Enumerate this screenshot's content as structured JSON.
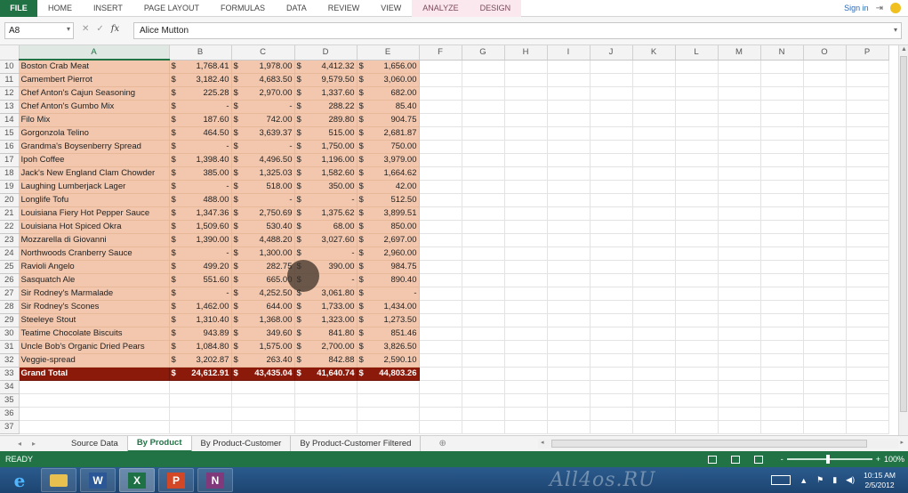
{
  "ribbon": {
    "file": "FILE",
    "tabs": [
      "HOME",
      "INSERT",
      "PAGE LAYOUT",
      "FORMULAS",
      "DATA",
      "REVIEW",
      "VIEW"
    ],
    "context_tabs": [
      "ANALYZE",
      "DESIGN"
    ],
    "signin": "Sign in"
  },
  "formula_bar": {
    "namebox": "A8",
    "fx": "fx",
    "cancel": "✕",
    "enter": "✓",
    "value": "Alice Mutton"
  },
  "columns": [
    "A",
    "B",
    "C",
    "D",
    "E",
    "F",
    "G",
    "H",
    "I",
    "J",
    "K",
    "L",
    "M",
    "N",
    "O",
    "P"
  ],
  "rows": [
    {
      "num": "10",
      "name": "Boston Crab Meat",
      "b": "1,768.41",
      "c": "1,978.00",
      "d": "4,412.32",
      "e": "1,656.00"
    },
    {
      "num": "11",
      "name": "Camembert Pierrot",
      "b": "3,182.40",
      "c": "4,683.50",
      "d": "9,579.50",
      "e": "3,060.00"
    },
    {
      "num": "12",
      "name": "Chef Anton's Cajun Seasoning",
      "b": "225.28",
      "c": "2,970.00",
      "d": "1,337.60",
      "e": "682.00"
    },
    {
      "num": "13",
      "name": "Chef Anton's Gumbo Mix",
      "b": "-",
      "c": "-",
      "d": "288.22",
      "e": "85.40"
    },
    {
      "num": "14",
      "name": "Filo Mix",
      "b": "187.60",
      "c": "742.00",
      "d": "289.80",
      "e": "904.75"
    },
    {
      "num": "15",
      "name": "Gorgonzola Telino",
      "b": "464.50",
      "c": "3,639.37",
      "d": "515.00",
      "e": "2,681.87"
    },
    {
      "num": "16",
      "name": "Grandma's Boysenberry Spread",
      "b": "-",
      "c": "-",
      "d": "1,750.00",
      "e": "750.00"
    },
    {
      "num": "17",
      "name": "Ipoh Coffee",
      "b": "1,398.40",
      "c": "4,496.50",
      "d": "1,196.00",
      "e": "3,979.00"
    },
    {
      "num": "18",
      "name": "Jack's New England Clam Chowder",
      "b": "385.00",
      "c": "1,325.03",
      "d": "1,582.60",
      "e": "1,664.62"
    },
    {
      "num": "19",
      "name": "Laughing Lumberjack Lager",
      "b": "-",
      "c": "518.00",
      "d": "350.00",
      "e": "42.00"
    },
    {
      "num": "20",
      "name": "Longlife Tofu",
      "b": "488.00",
      "c": "-",
      "d": "-",
      "e": "512.50"
    },
    {
      "num": "21",
      "name": "Louisiana Fiery Hot Pepper Sauce",
      "b": "1,347.36",
      "c": "2,750.69",
      "d": "1,375.62",
      "e": "3,899.51"
    },
    {
      "num": "22",
      "name": "Louisiana Hot Spiced Okra",
      "b": "1,509.60",
      "c": "530.40",
      "d": "68.00",
      "e": "850.00"
    },
    {
      "num": "23",
      "name": "Mozzarella di Giovanni",
      "b": "1,390.00",
      "c": "4,488.20",
      "d": "3,027.60",
      "e": "2,697.00"
    },
    {
      "num": "24",
      "name": "Northwoods Cranberry Sauce",
      "b": "-",
      "c": "1,300.00",
      "d": "-",
      "e": "2,960.00"
    },
    {
      "num": "25",
      "name": "Ravioli Angelo",
      "b": "499.20",
      "c": "282.75",
      "d": "390.00",
      "e": "984.75"
    },
    {
      "num": "26",
      "name": "Sasquatch Ale",
      "b": "551.60",
      "c": "665.00",
      "d": "-",
      "e": "890.40"
    },
    {
      "num": "27",
      "name": "Sir Rodney's Marmalade",
      "b": "-",
      "c": "4,252.50",
      "d": "3,061.80",
      "e": "-"
    },
    {
      "num": "28",
      "name": "Sir Rodney's Scones",
      "b": "1,462.00",
      "c": "644.00",
      "d": "1,733.00",
      "e": "1,434.00"
    },
    {
      "num": "29",
      "name": "Steeleye Stout",
      "b": "1,310.40",
      "c": "1,368.00",
      "d": "1,323.00",
      "e": "1,273.50"
    },
    {
      "num": "30",
      "name": "Teatime Chocolate Biscuits",
      "b": "943.89",
      "c": "349.60",
      "d": "841.80",
      "e": "851.46"
    },
    {
      "num": "31",
      "name": "Uncle Bob's Organic Dried Pears",
      "b": "1,084.80",
      "c": "1,575.00",
      "d": "2,700.00",
      "e": "3,826.50"
    },
    {
      "num": "32",
      "name": "Veggie-spread",
      "b": "3,202.87",
      "c": "263.40",
      "d": "842.88",
      "e": "2,590.10"
    },
    {
      "num": "33",
      "name": "Grand Total",
      "b": "24,612.91",
      "c": "43,435.04",
      "d": "41,640.74",
      "e": "44,803.26",
      "total": true
    },
    {
      "num": "34"
    },
    {
      "num": "35"
    },
    {
      "num": "36"
    },
    {
      "num": "37"
    }
  ],
  "currency_symbol": "$",
  "sheet_tabs": [
    "Source Data",
    "By Product",
    "By Product-Customer",
    "By Product-Customer Filtered"
  ],
  "active_sheet": "By Product",
  "new_sheet": "⊕",
  "status": {
    "text": "READY",
    "zoom": "100%",
    "zoom_minus": "-",
    "zoom_plus": "+"
  },
  "watermark": "All4os.RU",
  "clock": {
    "time": "10:15 AM",
    "date": "2/5/2012"
  },
  "colors": {
    "excel_green": "#217346",
    "pivot_fill": "#f3c7ad",
    "total_fill": "#8b1a0a"
  }
}
